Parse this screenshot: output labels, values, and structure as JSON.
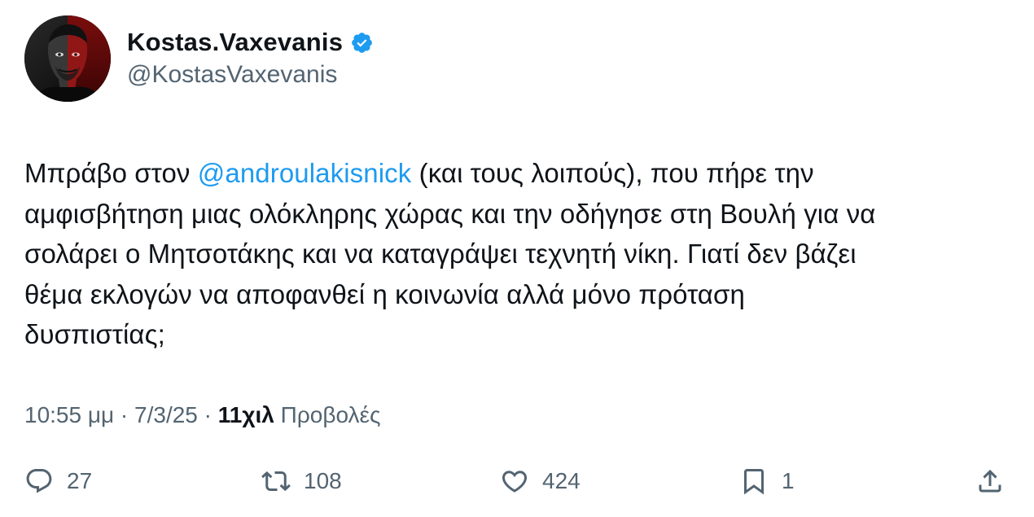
{
  "author": {
    "display_name": "Kostas.Vaxevanis",
    "handle": "@KostasVaxevanis",
    "verified": true,
    "verified_color": "#1d9bf0"
  },
  "tweet": {
    "text_before_mention": "Μπράβο στον ",
    "mention": "@androulakisnick",
    "text_after_mention": " (και τους λοιπούς), που πήρε την\nαμφισβήτηση μιας ολόκληρης χώρας και την οδήγησε στη Βουλή για να\nσολάρει ο Μητσοτάκης και να καταγράψει τεχνητή νίκη. Γιατί δεν βάζει\nθέμα εκλογών να αποφανθεί η κοινωνία αλλά μόνο πρόταση\nδυσπιστίας;"
  },
  "meta": {
    "time": "10:55 μμ",
    "separator": " · ",
    "date": "7/3/25",
    "views_count": "11χιλ",
    "views_label": "Προβολές"
  },
  "actions": {
    "reply_count": "27",
    "retweet_count": "108",
    "like_count": "424",
    "bookmark_count": "1"
  },
  "colors": {
    "text_primary": "#0f1419",
    "text_secondary": "#536471",
    "accent": "#1d9bf0"
  },
  "icons": [
    "verified-badge-icon",
    "reply-icon",
    "retweet-icon",
    "like-icon",
    "bookmark-icon",
    "share-icon"
  ]
}
